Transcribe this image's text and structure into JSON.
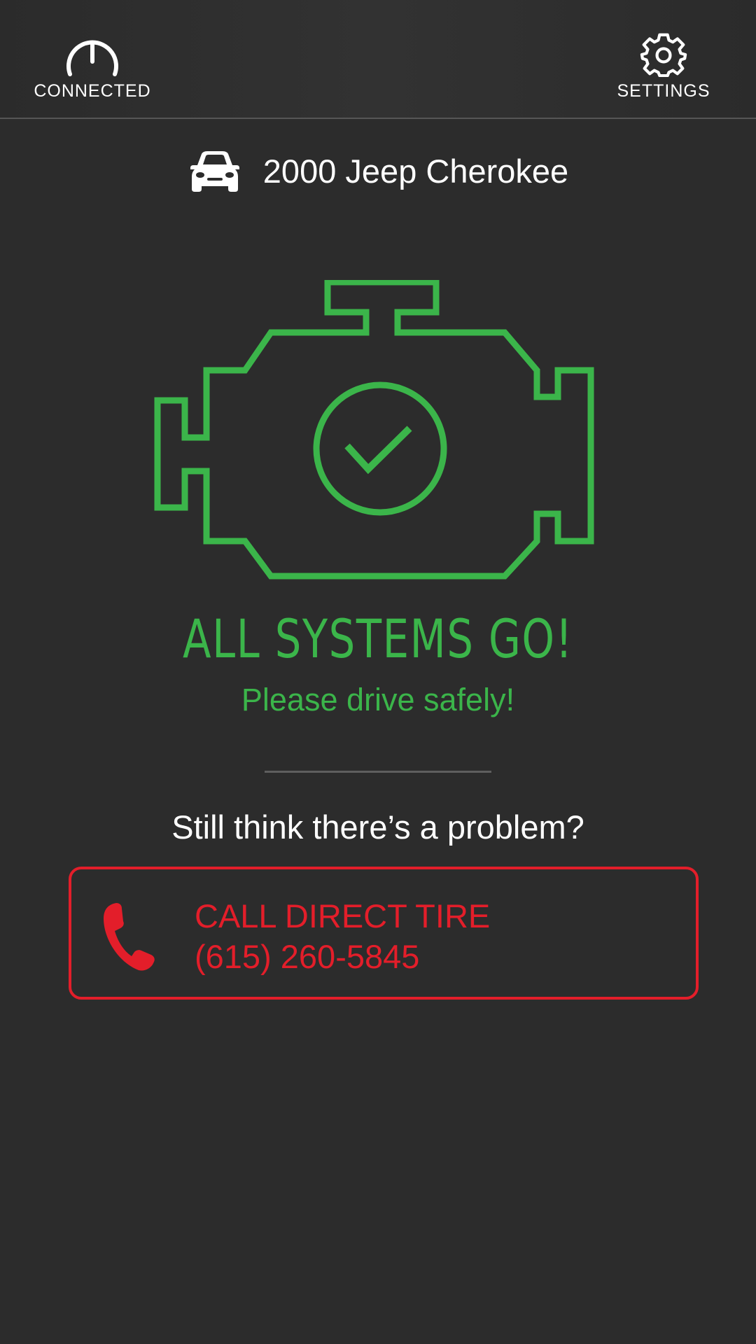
{
  "header": {
    "connected_label": "CONNECTED",
    "settings_label": "SETTINGS"
  },
  "vehicle": {
    "name": "2000 Jeep Cherokee",
    "icon": "car-icon"
  },
  "status": {
    "icon": "check-engine-ok-icon",
    "title": "ALL SYSTEMS GO!",
    "subtitle": "Please drive safely!"
  },
  "help": {
    "question": "Still think there’s a problem?",
    "call_label": "CALL DIRECT TIRE",
    "phone_number": "(615) 260-5845",
    "icon": "phone-icon"
  },
  "colors": {
    "background": "#2c2c2c",
    "ok_green": "#3bb54a",
    "alert_red": "#e31e2a",
    "text": "#ffffff"
  }
}
